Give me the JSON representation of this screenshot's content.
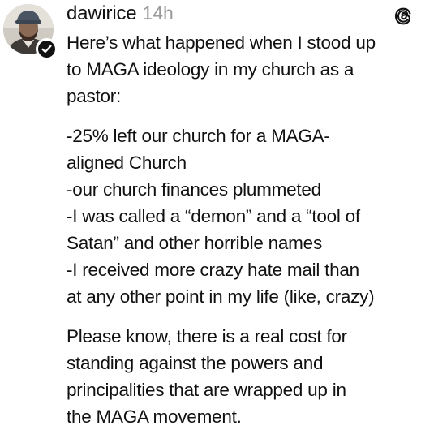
{
  "post": {
    "username": "dawirice",
    "timestamp": "14h",
    "icons": {
      "avatar": "profile-photo",
      "verified": "verified-badge-icon",
      "app": "threads-logo-icon"
    },
    "intro": "Here’s what happened when I stood up\nto MAGA ideology in my church as a\npastor:",
    "bullets": [
      "-25% left our church for a MAGA-\naligned Church",
      "-our church finances plummeted",
      "-I was called a “demon” and a “tool of\nSatan” and other horrible names",
      "-I received more crazy hate mail than\nat any other point in my life (like, crazy)"
    ],
    "closing": "Please know, there is a real cost for\nstanding against the powers and\nprincipalities that are wrapped up in\nthe MAGA movement."
  }
}
